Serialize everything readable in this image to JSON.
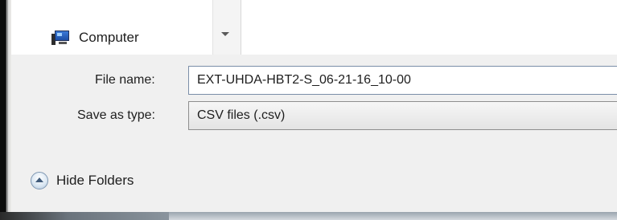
{
  "navigation": {
    "computer_label": "Computer"
  },
  "form": {
    "file_name_label": "File name:",
    "file_name_value": "EXT-UHDA-HBT2-S_06-21-16_10-00",
    "save_as_type_label": "Save as type:",
    "save_as_type_value": "CSV files (.csv)"
  },
  "footer": {
    "hide_folders_label": "Hide Folders"
  },
  "icons": {
    "computer": "computer-icon",
    "nav_dropdown": "chevron-down-icon",
    "hide_folders": "chevron-up-circle-icon"
  }
}
